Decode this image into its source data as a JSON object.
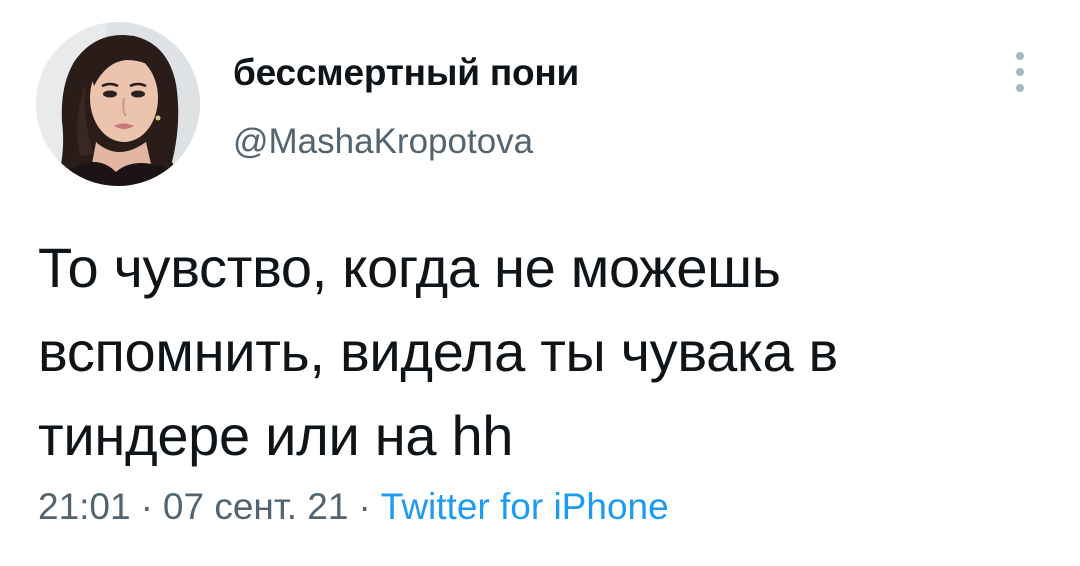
{
  "user": {
    "display_name": "бессмертный пони",
    "handle": "@MashaKropotova",
    "avatar_icon": "profile-photo"
  },
  "tweet": {
    "text_lines": [
      "То чувство, когда не можешь",
      "вспомнить, видела ты чувака в",
      "тиндере или на hh"
    ]
  },
  "meta": {
    "time": "21:01",
    "separator": "·",
    "date": "07 сент. 21",
    "source": "Twitter for iPhone"
  },
  "icons": {
    "more": "more-vertical-icon"
  },
  "colors": {
    "text": "#0f1419",
    "secondary": "#536471",
    "link": "#1d9bf0"
  }
}
